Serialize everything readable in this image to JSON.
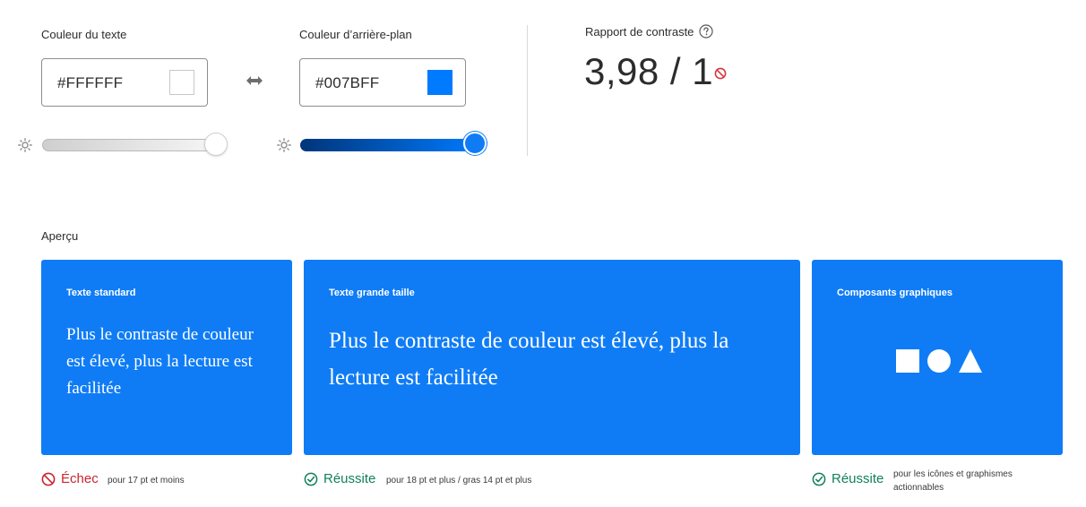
{
  "text_color": {
    "label": "Couleur du texte",
    "value": "#FFFFFF",
    "swatch": "#ffffff",
    "brightness": 1.0
  },
  "background_color": {
    "label": "Couleur d’arrière-plan",
    "value": "#007BFF",
    "swatch": "#007bff",
    "brightness": 1.0
  },
  "contrast": {
    "label": "Rapport de contraste",
    "value": "3,98 / 1",
    "status_color": "#d7373f"
  },
  "preview": {
    "label": "Aperçu",
    "card_background": "#0f7cf6",
    "card_text_color": "#ffffff",
    "cards": [
      {
        "title": "Texte standard",
        "sample": "Plus le contraste de couleur est élevé, plus la lecture est facilitée",
        "status": "Échec",
        "status_type": "fail",
        "note": "pour 17 pt et moins"
      },
      {
        "title": "Texte grande taille",
        "sample": "Plus le contraste de couleur est élevé, plus la lecture est facilitée",
        "status": "Réussite",
        "status_type": "pass",
        "note": "pour 18 pt et plus / gras 14 pt et plus"
      },
      {
        "title": "Composants graphiques",
        "shapes": [
          "square-icon",
          "circle-icon",
          "triangle-icon"
        ],
        "status": "Réussite",
        "status_type": "pass",
        "note": "pour les icônes et graphismes actionnables"
      }
    ]
  },
  "colors": {
    "fail": "#c9252d",
    "pass": "#12805c",
    "accent": "#0d66d0"
  }
}
